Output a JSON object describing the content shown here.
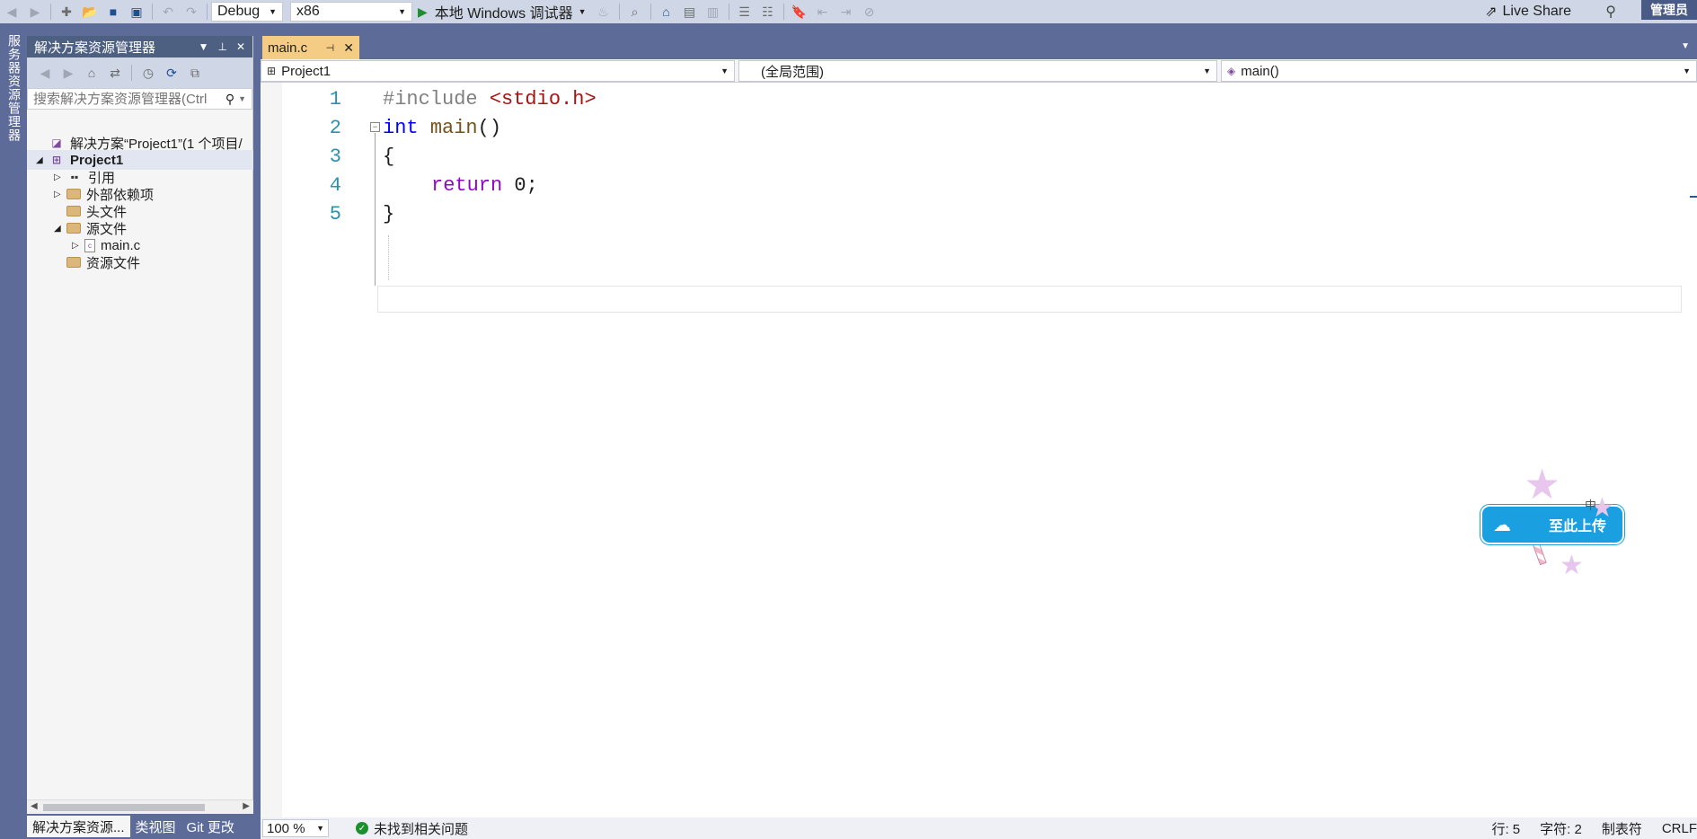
{
  "toolbar": {
    "config": "Debug",
    "platform": "x86",
    "run_label": "本地 Windows 调试器",
    "liveshare": "Live Share",
    "admin": "管理员",
    "icons": [
      "back-icon",
      "forward-icon",
      "new-project-icon",
      "open-folder-icon",
      "save-icon",
      "save-all-icon",
      "undo-icon",
      "redo-icon",
      "flame-icon",
      "find-icon",
      "home-icon",
      "comment-icon",
      "bookmark-icon"
    ]
  },
  "side_strip": {
    "label": "服务器资源管理器"
  },
  "solution_explorer": {
    "title": "解决方案资源管理器",
    "search_placeholder": "搜索解决方案资源管理器(Ctrl",
    "tree": [
      {
        "label": "解决方案“Project1”(1 个项目/",
        "icon": "solution-icon"
      },
      {
        "label": "Project1",
        "icon": "project-icon"
      },
      {
        "label": "引用",
        "icon": "references-icon"
      },
      {
        "label": "外部依赖项",
        "icon": "external-deps-icon"
      },
      {
        "label": "头文件",
        "icon": "folder-icon"
      },
      {
        "label": "源文件",
        "icon": "folder-icon"
      },
      {
        "label": "main.c",
        "icon": "c-file-icon"
      },
      {
        "label": "资源文件",
        "icon": "folder-icon"
      }
    ],
    "bottom_tabs": [
      "解决方案资源...",
      "类视图",
      "Git 更改"
    ]
  },
  "editor_tabs": [
    {
      "label": "main.c",
      "active": true
    }
  ],
  "nav_bar": {
    "project": "Project1",
    "scope": "(全局范围)",
    "member": "main()"
  },
  "code": {
    "line_numbers": [
      "1",
      "2",
      "3",
      "4",
      "5"
    ],
    "line1_directive": "#include",
    "line1_header": "<stdio.h>",
    "line2_type": "int",
    "line2_name": "main",
    "line2_parens": "()",
    "line3": "{",
    "line4_keyword": "return",
    "line4_rest": " 0;",
    "line5": "}"
  },
  "upload_widget": {
    "label": "至此上传",
    "decoration_text": "中"
  },
  "status_bar": {
    "zoom": "100 %",
    "issues": "未找到相关问题",
    "line": "行: 5",
    "char": "字符: 2",
    "tabs": "制表符",
    "eol": "CRLF"
  },
  "colors": {
    "accent": "#5d6b99",
    "tab_active": "#f5cc84",
    "keyword_blue": "#0000ff",
    "keyword_purple": "#8f08c4",
    "string_red": "#a31515",
    "line_number": "#2b91af"
  }
}
